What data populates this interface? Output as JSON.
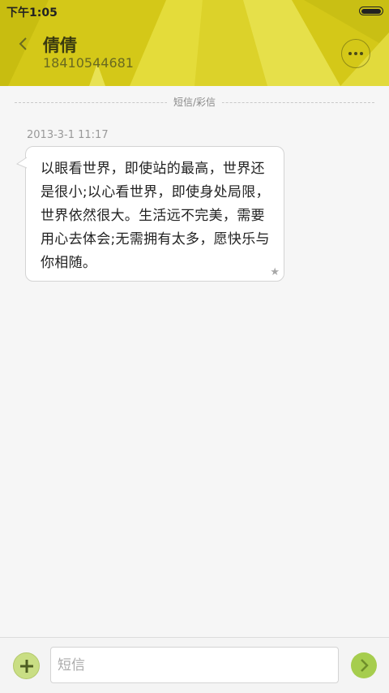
{
  "status_bar": {
    "time": "下午1:05"
  },
  "header": {
    "contact_name": "倩倩",
    "phone_number": "18410544681",
    "back_icon": "chevron-left-icon",
    "more_icon": "more-dots-icon",
    "color": "#d4c818"
  },
  "thread": {
    "divider_label": "短信/彩信",
    "messages": [
      {
        "timestamp": "2013-3-1 11:17",
        "text": "以眼看世界，即使站的最高，世界还是很小;以心看世界，即使身处局限，世界依然很大。生活远不完美，需要用心去体会;无需拥有太多，愿快乐与你相随。",
        "starred_icon": "star-icon"
      }
    ]
  },
  "composer": {
    "placeholder": "短信",
    "add_icon": "plus-icon",
    "send_icon": "send-arrow-icon",
    "accent": "#a6cd4e"
  }
}
